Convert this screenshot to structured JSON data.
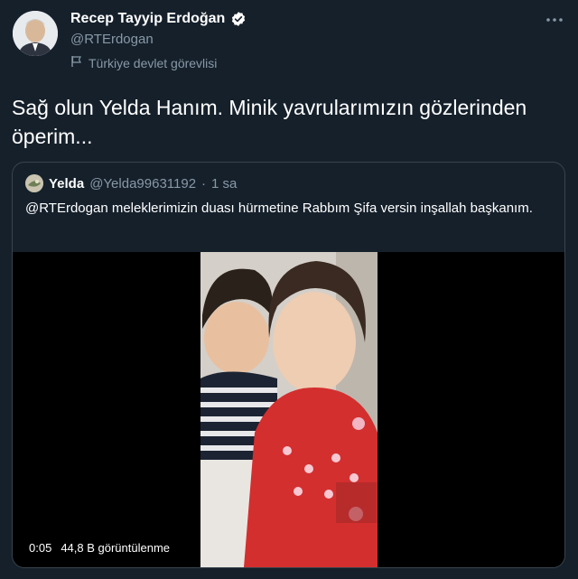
{
  "author": {
    "display_name": "Recep Tayyip Erdoğan",
    "handle": "@RTErdogan",
    "label": "Türkiye devlet görevlisi"
  },
  "tweet": {
    "text": "Sağ olun Yelda Hanım. Minik yavrularımızın gözlerinden öperim..."
  },
  "quoted": {
    "display_name": "Yelda",
    "handle": "@Yelda99631192",
    "separator": "·",
    "time": "1 sa",
    "text": "@RTErdogan meleklerimizin duası hürmetine Rabbım Şifa versin inşallah başkanım.",
    "video": {
      "elapsed": "0:05",
      "views": "44,8 B görüntülenme"
    }
  },
  "icons": {
    "verified": "verified-badge-icon",
    "flag": "flag-icon",
    "more": "more-icon"
  },
  "colors": {
    "background": "#15202b",
    "secondary_text": "#8899a6",
    "border": "#38444d",
    "primary_text": "#ffffff"
  }
}
